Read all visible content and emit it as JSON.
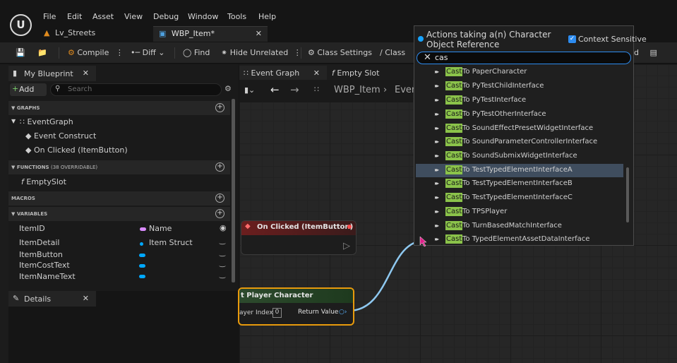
{
  "menu": [
    "File",
    "Edit",
    "Asset",
    "View",
    "Debug",
    "Window",
    "Tools",
    "Help"
  ],
  "tabs": {
    "level": "Lv_Streets",
    "blueprint": "WBP_Item*"
  },
  "toolbar": {
    "compile": "Compile",
    "diff": "Diff",
    "find": "Find",
    "hide_unrelated": "Hide Unrelated",
    "class_settings": "Class Settings",
    "class_defaults": "Class",
    "designer_partial": "d"
  },
  "my_blueprint": {
    "tab_label": "My Blueprint",
    "add_label": "Add",
    "search_placeholder": "Search",
    "sections": {
      "graphs": "GRAPHS",
      "functions": "FUNCTIONS",
      "functions_count": "(38 OVERRIDABLE)",
      "macros": "MACROS",
      "variables": "VARIABLES"
    },
    "graphs": {
      "event_graph": "EventGraph",
      "events": [
        "Event Construct",
        "On Clicked (ItemButton)"
      ]
    },
    "functions": [
      "EmptySlot"
    ],
    "variables": [
      {
        "name": "ItemID",
        "type": "Name",
        "type_color": "#d98bff"
      },
      {
        "name": "ItemDetail",
        "type": "Item Struct",
        "type_color": "#1aa3ff"
      },
      {
        "name": "ItemButton",
        "type": "",
        "type_color": "#00a8ff"
      },
      {
        "name": "ItemCostText",
        "type": "",
        "type_color": "#00a8ff"
      },
      {
        "name": "ItemNameText",
        "type": "",
        "type_color": "#00a8ff"
      }
    ]
  },
  "details": {
    "tab_label": "Details"
  },
  "graph_tabs": {
    "event_graph": "Event Graph",
    "empty_slot": "Empty Slot"
  },
  "breadcrumb": {
    "root": "WBP_Item",
    "current": "Even"
  },
  "nodes": {
    "on_clicked": "On Clicked (ItemButton)",
    "get_player": {
      "title": "t Player Character",
      "input": "ayer Index",
      "input_value": "0",
      "output": "Return Value"
    }
  },
  "context_menu": {
    "title": "Actions taking a(n) Character Object Reference",
    "context_sensitive": "Context Sensitive",
    "search_value": "cas",
    "match": "Cast",
    "items": [
      "Cast To PaperCharacter",
      "Cast To PyTestChildInterface",
      "Cast To PyTestInterface",
      "Cast To PyTestOtherInterface",
      "Cast To SoundEffectPresetWidgetInterface",
      "Cast To SoundParameterControllerInterface",
      "Cast To SoundSubmixWidgetInterface",
      "Cast To TestTypedElementInterfaceA",
      "Cast To TestTypedElementInterfaceB",
      "Cast To TestTypedElementInterfaceC",
      "Cast To TPSPlayer",
      "Cast To TurnBasedMatchInterface",
      "Cast To TypedElementAssetDataInterface"
    ],
    "items_rest": [
      "To PaperCharacter",
      "To PyTestChildInterface",
      "To PyTestInterface",
      "To PyTestOtherInterface",
      "To SoundEffectPresetWidgetInterface",
      "To SoundParameterControllerInterface",
      "To SoundSubmixWidgetInterface",
      "To TestTypedElementInterfaceA",
      "To TestTypedElementInterfaceB",
      "To TestTypedElementInterfaceC",
      "To TPSPlayer",
      "To TurnBasedMatchInterface",
      "To TypedElementAssetDataInterface"
    ],
    "selected_index": 7
  },
  "colors": {
    "accent": "#2d8cf0",
    "match_highlight": "#8bc34a",
    "selected_row": "#3f4d5e",
    "wire": "#8ec8f0",
    "selected_node_border": "#e89a0c"
  }
}
